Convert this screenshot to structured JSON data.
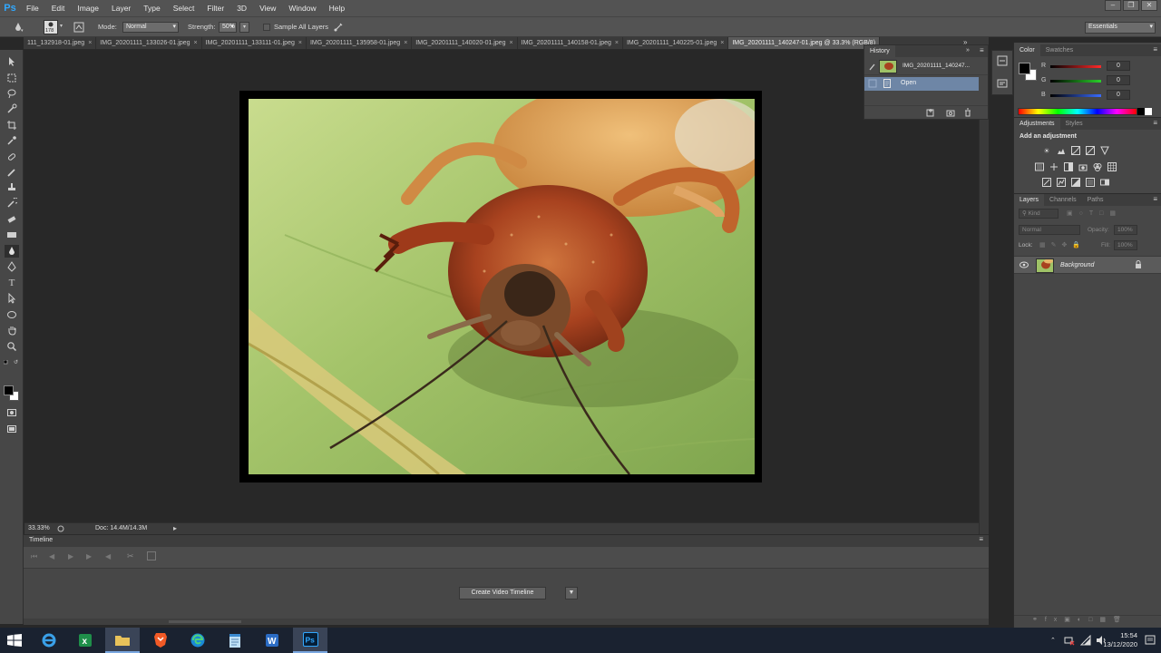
{
  "app": {
    "logo": "Ps",
    "menu": [
      "File",
      "Edit",
      "Image",
      "Layer",
      "Type",
      "Select",
      "Filter",
      "3D",
      "View",
      "Window",
      "Help"
    ],
    "window_controls": [
      "–",
      "❐",
      "✕"
    ]
  },
  "options_bar": {
    "brush_size": "178",
    "mode_label": "Mode:",
    "mode_value": "Normal",
    "strength_label": "Strength:",
    "strength_value": "50%",
    "sample_all_layers_label": "Sample All Layers",
    "sample_all_layers_checked": false,
    "workspace": "Essentials"
  },
  "tabs": [
    {
      "label": "111_132918-01.jpeg",
      "active": false
    },
    {
      "label": "IMG_20201111_133026-01.jpeg",
      "active": false
    },
    {
      "label": "IMG_20201111_133111-01.jpeg",
      "active": false
    },
    {
      "label": "IMG_20201111_135958-01.jpeg",
      "active": false
    },
    {
      "label": "IMG_20201111_140020-01.jpeg",
      "active": false
    },
    {
      "label": "IMG_20201111_140158-01.jpeg",
      "active": false
    },
    {
      "label": "IMG_20201111_140225-01.jpeg",
      "active": false
    },
    {
      "label": "IMG_20201111_140247-01.jpeg @ 33.3% (RGB/8)",
      "active": true
    }
  ],
  "tabs_overflow": "»",
  "status": {
    "zoom": "33.33%",
    "doc_info": "Doc: 14.4M/14.3M"
  },
  "timeline": {
    "title": "Timeline",
    "create_button": "Create Video Timeline"
  },
  "history": {
    "tab": "History",
    "snapshot_name": "IMG_20201111_140247...",
    "steps": [
      "Open"
    ]
  },
  "color_panel": {
    "tabs": [
      "Color",
      "Swatches"
    ],
    "channels": [
      {
        "label": "R",
        "value": "0",
        "color": "#ff2a2a"
      },
      {
        "label": "G",
        "value": "0",
        "color": "#2ad12a"
      },
      {
        "label": "B",
        "value": "0",
        "color": "#3a6cff"
      }
    ]
  },
  "adjustments_panel": {
    "tabs": [
      "Adjustments",
      "Styles"
    ],
    "heading": "Add an adjustment"
  },
  "layers_panel": {
    "tabs": [
      "Layers",
      "Channels",
      "Paths"
    ],
    "kind_label": "Kind",
    "blend_mode": "Normal",
    "opacity_label": "Opacity:",
    "opacity_value": "100%",
    "lock_label": "Lock:",
    "fill_label": "Fill:",
    "fill_value": "100%",
    "layers": [
      {
        "name": "Background",
        "locked": true,
        "visible": true
      }
    ]
  },
  "taskbar": {
    "time": "15:54",
    "date": "13/12/2020",
    "apps": [
      "internet-explorer",
      "excel",
      "file-explorer",
      "brave",
      "edge",
      "notepad",
      "word",
      "photoshop"
    ]
  }
}
